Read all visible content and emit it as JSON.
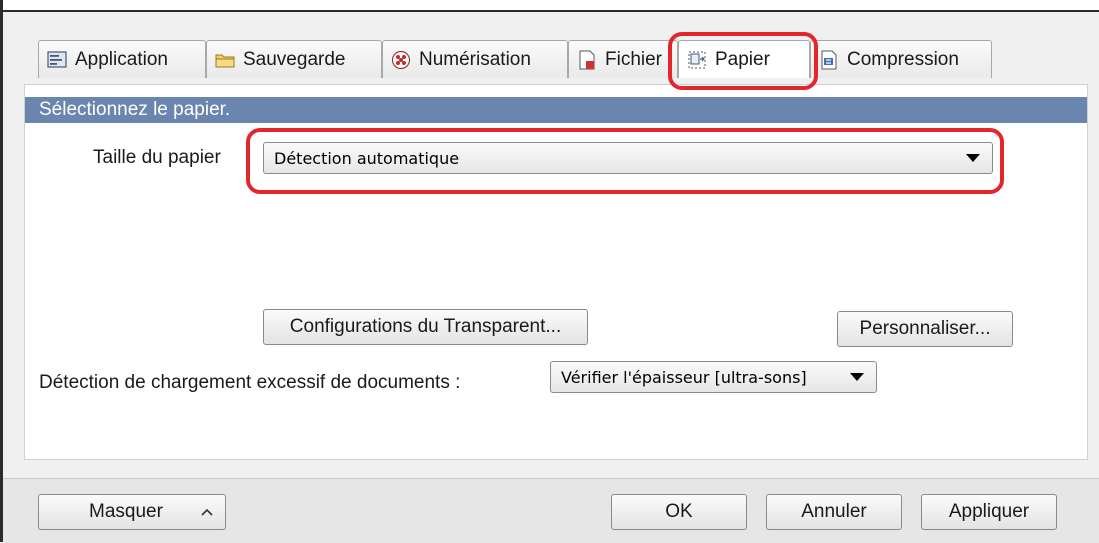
{
  "tabs": [
    {
      "label": "Application",
      "icon": "application-icon"
    },
    {
      "label": "Sauvegarde",
      "icon": "folder-icon"
    },
    {
      "label": "Numérisation",
      "icon": "scan-icon"
    },
    {
      "label": "Fichier",
      "icon": "file-icon"
    },
    {
      "label": "Papier",
      "icon": "paper-icon",
      "active": true
    },
    {
      "label": "Compression",
      "icon": "compression-icon"
    }
  ],
  "section": {
    "header": "Sélectionnez le papier."
  },
  "paper_size": {
    "label": "Taille du papier",
    "value": "Détection automatique"
  },
  "buttons": {
    "transparent": "Configurations du Transparent...",
    "customize": "Personnaliser..."
  },
  "multifeed": {
    "label": "Détection de chargement excessif de documents :",
    "value": "Vérifier l'épaisseur [ultra-sons]"
  },
  "footer": {
    "hide": "Masquer",
    "ok": "OK",
    "cancel": "Annuler",
    "apply": "Appliquer"
  },
  "colors": {
    "section_header_bg": "#6b86ae",
    "highlight": "#e3262e"
  }
}
